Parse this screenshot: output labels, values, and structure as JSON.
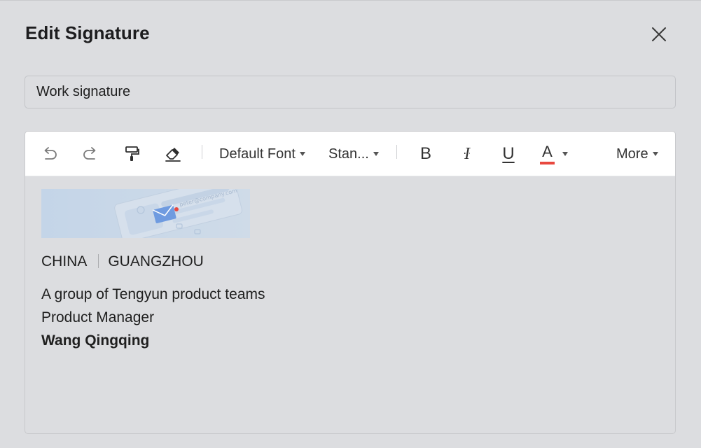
{
  "dialog": {
    "title": "Edit Signature"
  },
  "name_input": {
    "value": "Work signature"
  },
  "toolbar": {
    "font_label": "Default Font",
    "size_label": "Stan...",
    "bold_label": "B",
    "italic_label": "I",
    "underline_label": "U",
    "color_label": "A",
    "more_label": "More",
    "text_color": "#e8483f"
  },
  "signature": {
    "banner_email": "peter@company.com",
    "country": "CHINA",
    "city": "GUANGZHOU",
    "company": "A group of Tengyun product teams",
    "position": "Product Manager",
    "name": "Wang Qingqing"
  },
  "colors": {
    "background": "#dcdde0",
    "toolbar_bg": "#ffffff",
    "accent_red": "#e8483f"
  }
}
